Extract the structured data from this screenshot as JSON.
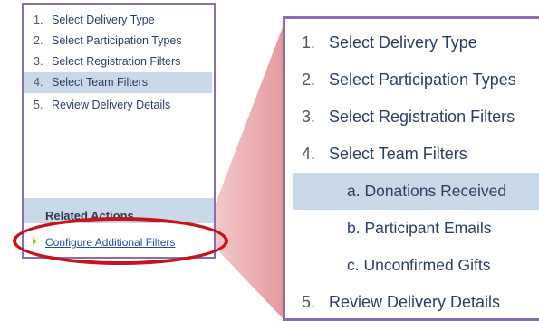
{
  "small_panel": {
    "steps": [
      {
        "num": "1.",
        "label": "Select Delivery Type"
      },
      {
        "num": "2.",
        "label": "Select Participation Types"
      },
      {
        "num": "3.",
        "label": "Select Registration Filters"
      },
      {
        "num": "4.",
        "label": "Select Team Filters"
      },
      {
        "num": "5.",
        "label": "Review Delivery Details"
      }
    ],
    "active_step_index": 3,
    "related_actions_title": "Related Actions",
    "related_link": "Configure Additional Filters"
  },
  "zoomed_panel": {
    "steps_before": [
      {
        "num": "1.",
        "label": "Select Delivery Type"
      },
      {
        "num": "2.",
        "label": "Select Participation Types"
      },
      {
        "num": "3.",
        "label": "Select Registration Filters"
      },
      {
        "num": "4.",
        "label": "Select Team Filters"
      }
    ],
    "sub_steps": [
      {
        "label": "a. Donations Received"
      },
      {
        "label": "b. Participant Emails"
      },
      {
        "label": "c. Unconfirmed Gifts"
      }
    ],
    "active_sub_index": 0,
    "steps_after": [
      {
        "num": "5.",
        "label": "Review Delivery Details"
      }
    ]
  },
  "colors": {
    "panel_border": "#8a6fae",
    "highlight": "#c9d9ea",
    "link": "#1e4fa0",
    "callout_oval": "#c2151c",
    "zoom_wedge": "#e8a0a3",
    "bullet": "#9bbc2a"
  }
}
